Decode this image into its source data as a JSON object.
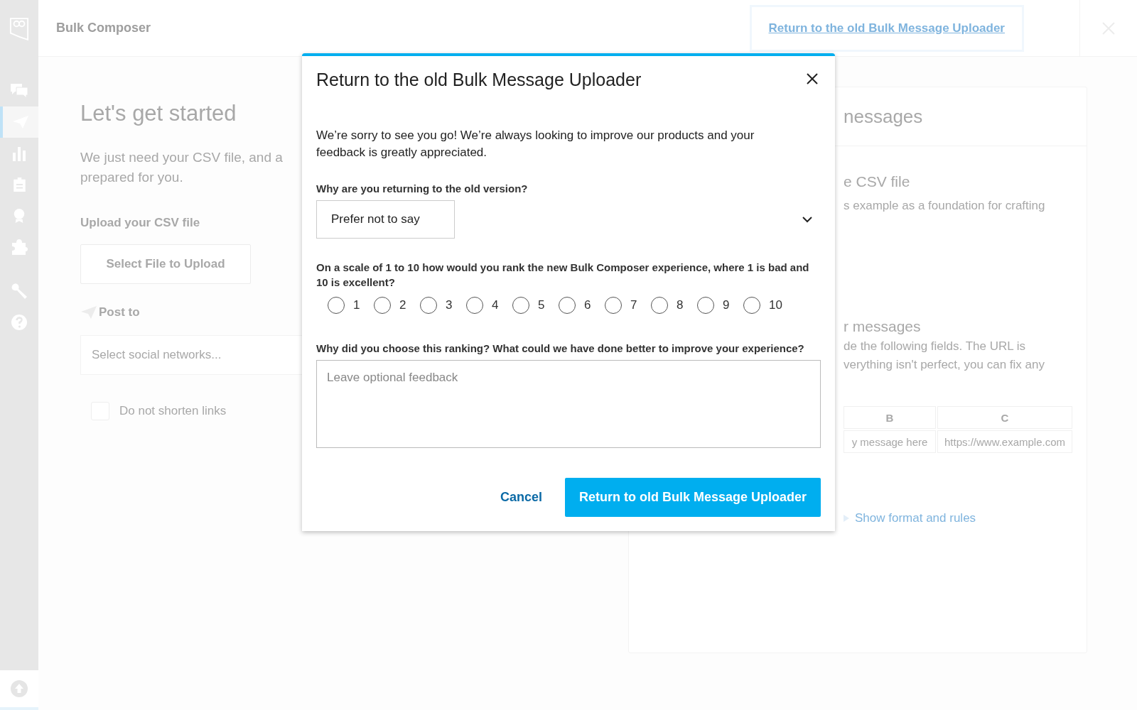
{
  "sidebar": {
    "items": [
      {
        "kind": "streams",
        "selected": false
      },
      {
        "kind": "publisher",
        "selected": true
      },
      {
        "kind": "analytics",
        "selected": false
      },
      {
        "kind": "assignments",
        "selected": false
      },
      {
        "kind": "campaigns",
        "selected": false
      },
      {
        "kind": "apps",
        "selected": false
      },
      {
        "kind": "tools",
        "selected": false
      },
      {
        "kind": "help",
        "selected": false
      }
    ]
  },
  "header": {
    "title": "Bulk Composer",
    "link": "Return to the old Bulk Message Uploader"
  },
  "left": {
    "heading": "Let's get started",
    "intro_lines": [
      "We just need your CSV file, and a",
      "prepared for you."
    ],
    "upload_label": "Upload your CSV file",
    "upload_button": "Select File to Upload",
    "post_to": "Post to",
    "networks_placeholder": "Select social networks...",
    "shorten": {
      "label": "Do not shorten links",
      "checked": false
    }
  },
  "right": {
    "heading": "nessages",
    "section_1_heading": "e CSV file",
    "section_1_text": "s example as a foundation for crafting",
    "section_2_heading": "r messages",
    "section_2_lines": [
      "de the following fields. The URL is",
      "verything isn't perfect, you can fix any"
    ],
    "table": {
      "columns": [
        "B",
        "C"
      ],
      "rows": [
        [
          "y message here",
          "https://www.example.com"
        ]
      ]
    },
    "toggle": "Show format and rules"
  },
  "modal": {
    "title": "Return to the old Bulk Message Uploader",
    "intro": "We’re sorry to see you go! We’re always looking to improve our products and your feedback is greatly appreciated.",
    "question_1": "Why are you returning to the old version?",
    "reason": "Prefer not to say",
    "question_2": "On a scale of 1 to 10 how would you rank the new Bulk Composer experience, where 1 is bad and 10 is excellent?",
    "scale": [
      {
        "label": "1",
        "selected": false
      },
      {
        "label": "2",
        "selected": false
      },
      {
        "label": "3",
        "selected": false
      },
      {
        "label": "4",
        "selected": false
      },
      {
        "label": "5",
        "selected": false
      },
      {
        "label": "6",
        "selected": false
      },
      {
        "label": "7",
        "selected": false
      },
      {
        "label": "8",
        "selected": false
      },
      {
        "label": "9",
        "selected": false
      },
      {
        "label": "10",
        "selected": false
      }
    ],
    "question_3": "Why did you choose this ranking? What could we have done better to improve your experience?",
    "feedback_placeholder": "Leave optional feedback",
    "cancel": "Cancel",
    "submit": "Return to old Bulk Message Uploader"
  }
}
